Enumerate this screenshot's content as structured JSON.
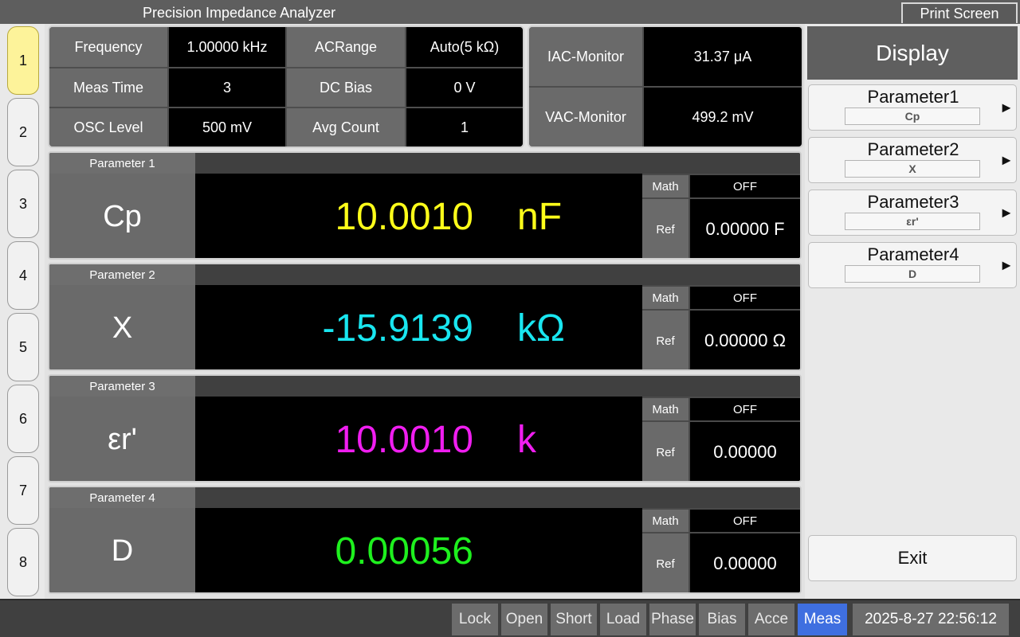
{
  "app": {
    "title": "Precision Impedance Analyzer",
    "print_label": "Print Screen"
  },
  "tabs": [
    "1",
    "2",
    "3",
    "4",
    "5",
    "6",
    "7",
    "8"
  ],
  "active_tab": "1",
  "settings": {
    "frequency_label": "Frequency",
    "frequency_value": "1.00000 kHz",
    "acrange_label": "ACRange",
    "acrange_value": "Auto(5 kΩ)",
    "meastime_label": "Meas Time",
    "meastime_value": "3",
    "dcbias_label": "DC Bias",
    "dcbias_value": "0 V",
    "osc_label": "OSC Level",
    "osc_value": "500 mV",
    "avg_label": "Avg Count",
    "avg_value": "1"
  },
  "monitor": {
    "iac_label": "IAC-Monitor",
    "iac_value": "31.37 μA",
    "vac_label": "VAC-Monitor",
    "vac_value": "499.2 mV"
  },
  "params": [
    {
      "tab": "Parameter 1",
      "name": "Cp",
      "value": "10.0010",
      "unit": "nF",
      "color": "#ffff1a",
      "math_label": "Math",
      "math_value": "OFF",
      "ref_label": "Ref",
      "ref_value": "0.00000 F"
    },
    {
      "tab": "Parameter 2",
      "name": "X",
      "value": "-15.9139",
      "unit": "kΩ",
      "color": "#19e6f0",
      "math_label": "Math",
      "math_value": "OFF",
      "ref_label": "Ref",
      "ref_value": "0.00000 Ω"
    },
    {
      "tab": "Parameter 3",
      "name": "εr'",
      "value": "10.0010",
      "unit": "k",
      "color": "#f01ef0",
      "math_label": "Math",
      "math_value": "OFF",
      "ref_label": "Ref",
      "ref_value": "0.00000"
    },
    {
      "tab": "Parameter 4",
      "name": "D",
      "value": "0.00056",
      "unit": "",
      "color": "#1ef01e",
      "math_label": "Math",
      "math_value": "OFF",
      "ref_label": "Ref",
      "ref_value": "0.00000"
    }
  ],
  "sidebar": {
    "header": "Display",
    "items": [
      {
        "label": "Parameter1",
        "value": "Cp"
      },
      {
        "label": "Parameter2",
        "value": "X"
      },
      {
        "label": "Parameter3",
        "value": "εr'"
      },
      {
        "label": "Parameter4",
        "value": "D"
      }
    ],
    "arrow": "►",
    "exit_label": "Exit"
  },
  "bottom": {
    "buttons": [
      "Lock",
      "Open",
      "Short",
      "Load",
      "Phase",
      "Bias",
      "Acce",
      "Meas"
    ],
    "active": "Meas",
    "datetime": "2025-8-27 22:56:12"
  }
}
